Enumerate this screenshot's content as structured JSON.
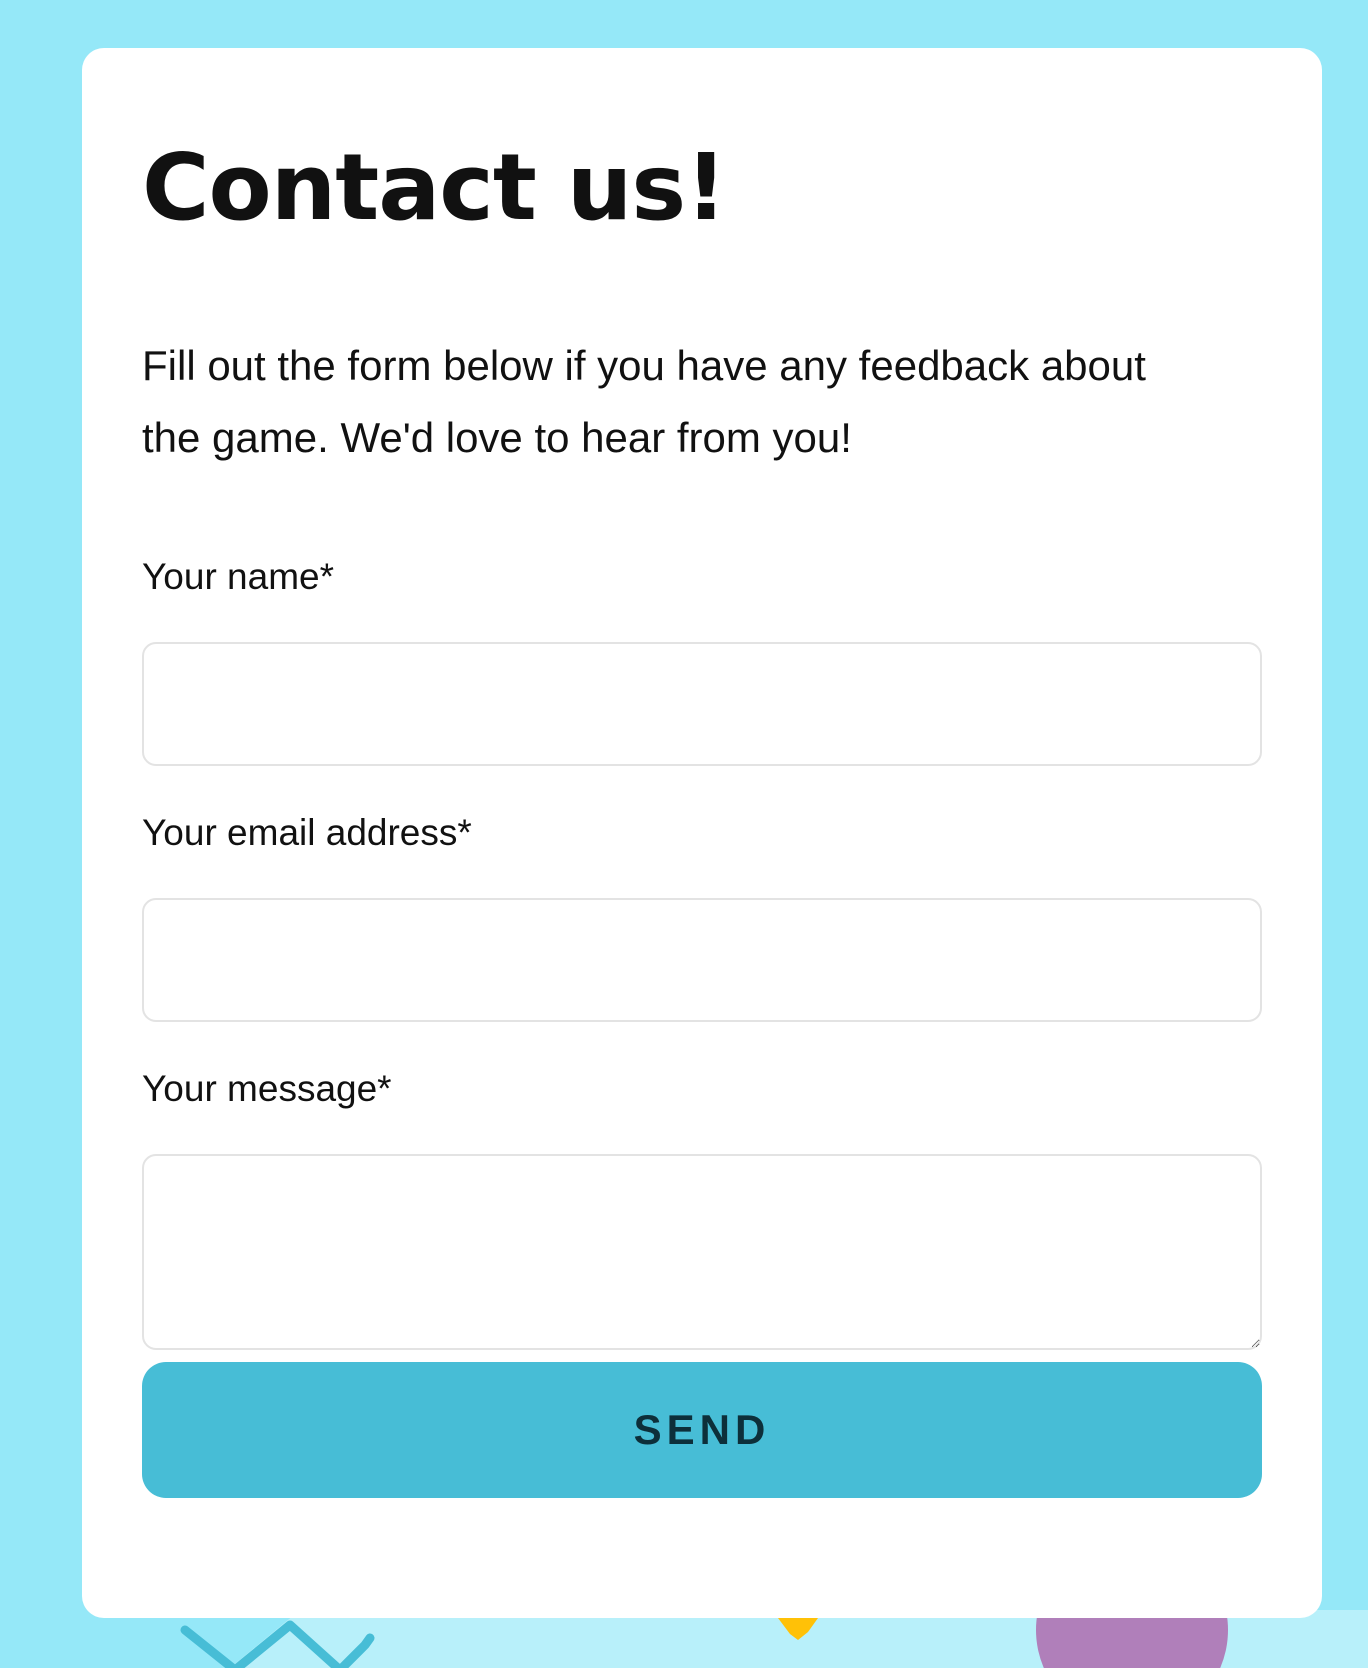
{
  "page": {
    "background_color": "#95e8f8",
    "accent_color": "#47bdd6"
  },
  "contact_form": {
    "title": "Contact us!",
    "intro": "Fill out the form below if you have any feedback about the game. We'd love to hear from you!",
    "fields": [
      {
        "label": "Your name*",
        "value": "",
        "placeholder": ""
      },
      {
        "label": "Your email address*",
        "value": "",
        "placeholder": ""
      },
      {
        "label": "Your message*",
        "value": "",
        "placeholder": ""
      }
    ],
    "send_label": "SEND"
  },
  "decorations": [
    {
      "icon": "zigzag-shape",
      "color": "#47bdd6"
    },
    {
      "icon": "star-shape",
      "color": "#ffc107"
    },
    {
      "icon": "circle-shape",
      "color": "#b07fba"
    }
  ]
}
